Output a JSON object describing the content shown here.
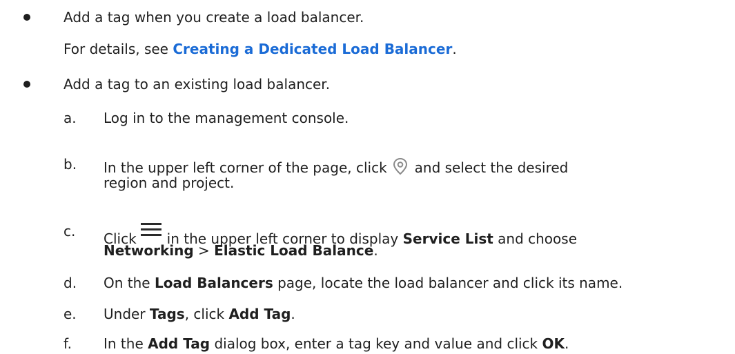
{
  "items": [
    {
      "text": "Add a tag when you create a load balancer.",
      "detail_prefix": "For details, see ",
      "detail_link": "Creating a Dedicated Load Balancer",
      "detail_suffix": "."
    },
    {
      "text": "Add a tag to an existing load balancer.",
      "steps": [
        {
          "letter": "a.",
          "text": "Log in to the management console."
        },
        {
          "letter": "b.",
          "text_before": "In the upper left corner of the page, click",
          "text_after": "and select the desired",
          "text_line2": "region and project.",
          "icon": "location-pin-icon"
        },
        {
          "letter": "c.",
          "text_before": "Click",
          "text_after": "in the upper left corner to display",
          "bold1": "Service List",
          "after_bold1": "and choose",
          "bold2": "Networking",
          "sep": ">",
          "bold3": "Elastic Load Balance",
          "end": ".",
          "icon": "hamburger-menu-icon"
        },
        {
          "letter": "d.",
          "before": "On the",
          "bold": "Load Balancers",
          "after": "page, locate the load balancer and click its name."
        },
        {
          "letter": "e.",
          "before": "Under",
          "bold": "Tags",
          "mid": ", click",
          "bold2": "Add Tag",
          "end": "."
        },
        {
          "letter": "f.",
          "before": "In the",
          "bold": "Add Tag",
          "mid": "dialog box, enter a tag key and value and click",
          "bold2": "OK",
          "end": "."
        }
      ]
    }
  ],
  "colors": {
    "text": "#1f1f1f",
    "link": "#1a6bd6",
    "icon": "#8a8a8a",
    "menu_icon": "#2a2a2a"
  }
}
